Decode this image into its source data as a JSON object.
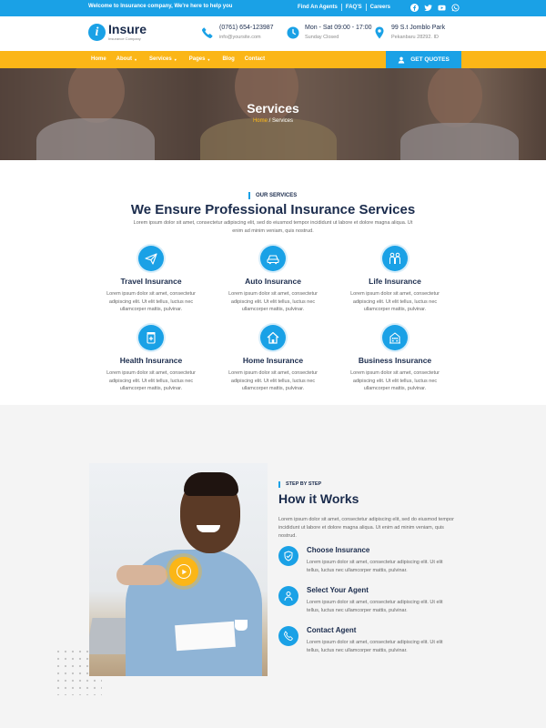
{
  "topbar": {
    "welcome": "Welcome to Insurance company, We're here to help you",
    "links": [
      "Find An Agents",
      "FAQ'S",
      "Careers"
    ],
    "social_icons": [
      "facebook-icon",
      "twitter-icon",
      "youtube-icon",
      "whatsapp-icon"
    ]
  },
  "header": {
    "logo_text": "Insure",
    "logo_sub": "Insurance Company",
    "phone": "(0761) 654-123987",
    "email": "info@yoursite.com",
    "hours": "Mon - Sat 09:00 - 17:00",
    "closed": "Sunday Closed",
    "address": "99 S.t Jomblo Park",
    "city": "Pekanbaru 28292. ID"
  },
  "nav": {
    "items": [
      {
        "label": "Home",
        "dropdown": false
      },
      {
        "label": "About",
        "dropdown": true
      },
      {
        "label": "Services",
        "dropdown": true
      },
      {
        "label": "Pages",
        "dropdown": true
      },
      {
        "label": "Blog",
        "dropdown": false
      },
      {
        "label": "Contact",
        "dropdown": false
      }
    ],
    "quote_button": "GET QUOTES"
  },
  "hero": {
    "title": "Services",
    "crumb_home": "Home",
    "crumb_sep": " / ",
    "crumb_current": "Services"
  },
  "services": {
    "tag": "OUR SERVICES",
    "title": "We Ensure Professional Insurance Services",
    "desc": "Lorem ipsum dolor sit amet, consectetur adipiscing elit, sed do eiusmod tempor incididunt ut labore et dolore magna aliqua. Ut enim ad minim veniam, quis nostrud.",
    "cards": [
      {
        "title": "Travel Insurance",
        "text": "Lorem ipsum dolor sit amet, consectetur adipiscing elit. Ut elit tellus, luctus nec ullamcorper mattis, pulvinar.",
        "icon": "paper-plane-icon"
      },
      {
        "title": "Auto Insurance",
        "text": "Lorem ipsum dolor sit amet, consectetur adipiscing elit. Ut elit tellus, luctus nec ullamcorper mattis, pulvinar.",
        "icon": "car-icon"
      },
      {
        "title": "Life Insurance",
        "text": "Lorem ipsum dolor sit amet, consectetur adipiscing elit. Ut elit tellus, luctus nec ullamcorper mattis, pulvinar.",
        "icon": "family-icon"
      },
      {
        "title": "Health Insurance",
        "text": "Lorem ipsum dolor sit amet, consectetur adipiscing elit. Ut elit tellus, luctus nec ullamcorper mattis, pulvinar.",
        "icon": "medicine-icon"
      },
      {
        "title": "Home Insurance",
        "text": "Lorem ipsum dolor sit amet, consectetur adipiscing elit. Ut elit tellus, luctus nec ullamcorper mattis, pulvinar.",
        "icon": "house-icon"
      },
      {
        "title": "Business Insurance",
        "text": "Lorem ipsum dolor sit amet, consectetur adipiscing elit. Ut elit tellus, luctus nec ullamcorper mattis, pulvinar.",
        "icon": "building-icon"
      }
    ]
  },
  "how": {
    "tag": "STEP BY STEP",
    "title": "How it Works",
    "desc": "Lorem ipsum dolor sit amet, consectetur adipiscing elit, sed do eiusmod tempor incididunt ut labore et dolore magna aliqua. Ut enim ad minim veniam, quis nostrud.",
    "steps": [
      {
        "title": "Choose Insurance",
        "text": "Lorem ipsum dolor sit amet, consectetur adipiscing elit. Ut elit tellus, luctus nec ullamcorper mattis, pulvinar.",
        "icon": "hand-shield-icon"
      },
      {
        "title": "Select Your Agent",
        "text": "Lorem ipsum dolor sit amet, consectetur adipiscing elit. Ut elit tellus, luctus nec ullamcorper mattis, pulvinar.",
        "icon": "agent-icon"
      },
      {
        "title": "Contact Agent",
        "text": "Lorem ipsum dolor sit amet, consectetur adipiscing elit. Ut elit tellus, luctus nec ullamcorper mattis, pulvinar.",
        "icon": "phone-icon"
      }
    ]
  },
  "colors": {
    "primary": "#1aa1e6",
    "accent": "#fbb617",
    "heading": "#1a2b4c"
  }
}
